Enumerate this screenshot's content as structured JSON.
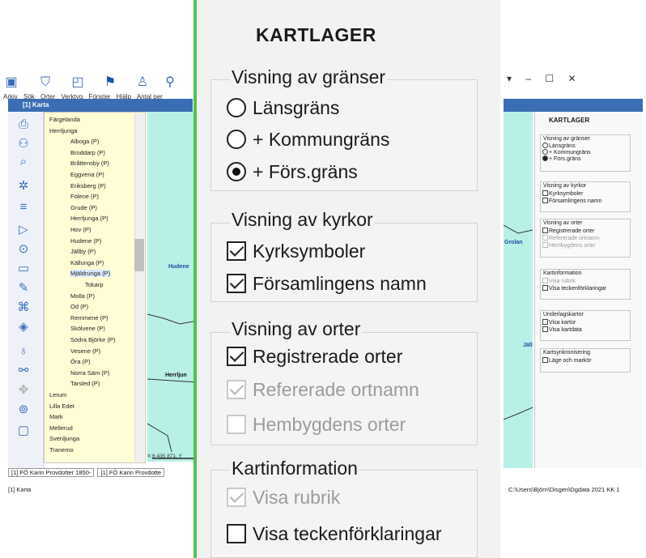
{
  "app": {
    "menu": [
      "Arkiv",
      "Sök",
      "Orter",
      "Verktyg",
      "Fönster",
      "Hjälp",
      "Antal per"
    ],
    "doc_title": "[1] Karta",
    "tree_items": [
      "Färgelanda",
      "Herrljunga",
      "Alboga (P)",
      "Broddarp (P)",
      "Bråttensby (P)",
      "Eggvena (P)",
      "Eriksberg (P)",
      "Fölene (P)",
      "Grude (P)",
      "Herrljunga (P)",
      "Hov (P)",
      "Hudene (P)",
      "Jällby (P)",
      "Källunga (P)",
      "Mjäldrunga (P)",
      "Tokarp",
      "Molla (P)",
      "Od (P)",
      "Remmene (P)",
      "Skölvene (P)",
      "Södra Björke (P)",
      "Vesene (P)",
      "Öra (P)",
      "Norra Säm (P)",
      "Tarsled (P)",
      "Lerum",
      "Lilla Edet",
      "Mark",
      "Mellerud",
      "Svenljunga",
      "Tranemo"
    ],
    "map_labels": [
      "Hudene",
      "Herrljun",
      "Grolan",
      "Jäll"
    ],
    "coord": "X:6 435 871, Y",
    "bottom_tabs": [
      "[1] FÖ Karin Provdotter 1850-",
      "[1] FÖ Karin Provdotte"
    ],
    "status_left": "[1] Karta",
    "status_right": "C:\\Users\\Björn\\Disgen\\Dgdata 2021 KK 1",
    "window_controls": [
      "–",
      "☐",
      "✕"
    ],
    "side_panel": {
      "title": "KARTLAGER",
      "lines": [
        "Visning av gränser",
        "Länsgräns",
        "+ Kommungräns",
        "+ Förs.gräns",
        "Visning av kyrkor",
        "Kyrksymboler",
        "Församlingens namn",
        "Visning av orter",
        "Registrerade orter",
        "Refererade ortnamn",
        "Hembygdens orter",
        "Kartinformation",
        "Visa rubrik",
        "Visa teckenförklaringar",
        "Underlagskartor",
        "Visa kartor",
        "Visa kartdata",
        "Kartsynkronisering",
        "Läge och markör"
      ]
    }
  },
  "popup": {
    "title": "KARTLAGER",
    "groups": {
      "borders": {
        "title": "Visning av gränser",
        "options": [
          {
            "label": "Länsgräns",
            "checked": false
          },
          {
            "label": "+ Kommungräns",
            "checked": false
          },
          {
            "label": "+ Förs.gräns",
            "checked": true
          }
        ]
      },
      "churches": {
        "title": "Visning av kyrkor",
        "options": [
          {
            "label": "Kyrksymboler",
            "checked": true
          },
          {
            "label": "Församlingens namn",
            "checked": true
          }
        ]
      },
      "places": {
        "title": "Visning av orter",
        "options": [
          {
            "label": "Registrerade orter",
            "checked": true,
            "enabled": true
          },
          {
            "label": "Refererade ortnamn",
            "checked": true,
            "enabled": false
          },
          {
            "label": "Hembygdens orter",
            "checked": false,
            "enabled": false
          }
        ]
      },
      "mapinfo": {
        "title": "Kartinformation",
        "options": [
          {
            "label": "Visa rubrik",
            "checked": true,
            "enabled": false
          },
          {
            "label": "Visa teckenförklaringar",
            "checked": false,
            "enabled": true
          }
        ]
      }
    }
  }
}
